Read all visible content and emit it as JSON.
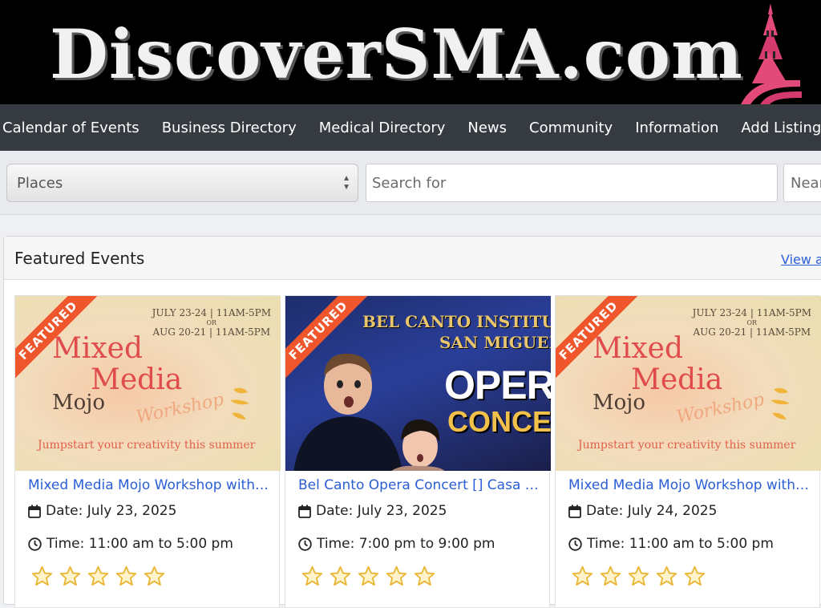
{
  "site": {
    "logo_text": "DiscoverSMA.com"
  },
  "nav": {
    "items": [
      "Calendar of Events",
      "Business Directory",
      "Medical Directory",
      "News",
      "Community",
      "Information",
      "Add Listing"
    ]
  },
  "search": {
    "places_label": "Places",
    "search_placeholder": "Search for",
    "near_placeholder": "Near"
  },
  "featured": {
    "title": "Featured Events",
    "view_all": "View a",
    "badge": "FEATURED",
    "cards": [
      {
        "title": "Mixed Media Mojo Workshop with …",
        "date": "Date: July 23, 2025",
        "time": "Time: 11:00 am to 5:00 pm",
        "stars": 5,
        "image": {
          "dates_line1": "JULY 23-24 | 11AM-5PM",
          "or": "OR",
          "dates_line2": "AUG 20-21 | 11AM-5PM",
          "mixed": "Mixed",
          "media": "Media",
          "mojo": "Mojo",
          "workshop": "Workshop",
          "tagline": "Jumpstart your creativity this summer"
        }
      },
      {
        "title": "Bel Canto Opera Concert [] Casa …",
        "date": "Date: July 23, 2025",
        "time": "Time: 7:00 pm to 9:00 pm",
        "stars": 5,
        "image": {
          "line1": "BEL CANTO INSTITUTE",
          "line2": "SAN MIGUEL",
          "opera": "OPERA",
          "concert": "CONCERT"
        }
      },
      {
        "title": "Mixed Media Mojo Workshop with …",
        "date": "Date: July 24, 2025",
        "time": "Time: 11:00 am to 5:00 pm",
        "stars": 5,
        "image": {
          "dates_line1": "JULY 23-24 | 11AM-5PM",
          "or": "OR",
          "dates_line2": "AUG 20-21 | 11AM-5PM",
          "mixed": "Mixed",
          "media": "Media",
          "mojo": "Mojo",
          "workshop": "Workshop",
          "tagline": "Jumpstart your creativity this summer"
        }
      }
    ]
  },
  "colors": {
    "nav_bg": "#353b41",
    "link": "#2a5fd6",
    "ribbon": "#f0562b",
    "star_fill": "#f4cf54"
  },
  "icons": {
    "date": "calendar-icon",
    "time": "clock-icon",
    "rating": "star-icon",
    "select": "up-down-arrows-icon"
  }
}
